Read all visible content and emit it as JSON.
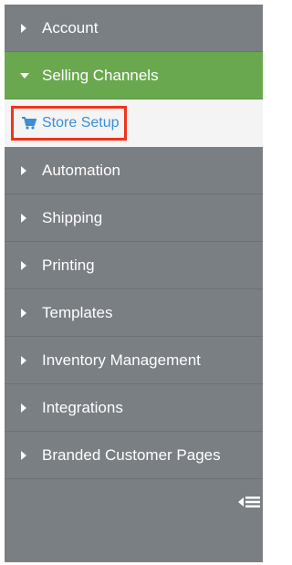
{
  "sidebar": {
    "items": [
      {
        "label": "Account"
      },
      {
        "label": "Selling Channels"
      },
      {
        "label": "Automation"
      },
      {
        "label": "Shipping"
      },
      {
        "label": "Printing"
      },
      {
        "label": "Templates"
      },
      {
        "label": "Inventory Management"
      },
      {
        "label": "Integrations"
      },
      {
        "label": "Branded Customer Pages"
      }
    ],
    "sub_item": {
      "label": "Store Setup",
      "icon": "shopping-cart-icon"
    },
    "colors": {
      "background": "#7a7f84",
      "active": "#6aa84f",
      "link": "#3a8fd6",
      "highlight_border": "#f0341a"
    },
    "collapse_icon": "collapse-sidebar-icon"
  }
}
